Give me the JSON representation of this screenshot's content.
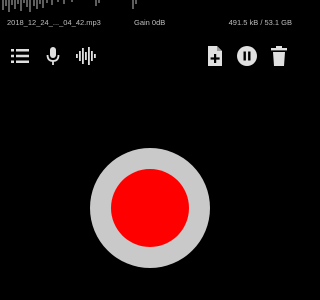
{
  "status": {
    "filename": "2018_12_24_..._04_42.mp3",
    "gain": "Gain 0dB",
    "size": "491.5 kB / 53.1 GB"
  },
  "toolbar": {
    "left_icons": [
      "list-icon",
      "microphone-icon",
      "waveform-icon"
    ],
    "right_icons": [
      "add-file-icon",
      "pause-icon",
      "delete-icon"
    ]
  },
  "record_button": {
    "outer_color": "#c9c9c9",
    "inner_color": "#ff0000"
  },
  "colors": {
    "background": "#000000",
    "icon": "#e0e0e0",
    "text": "#bdbdbd"
  }
}
